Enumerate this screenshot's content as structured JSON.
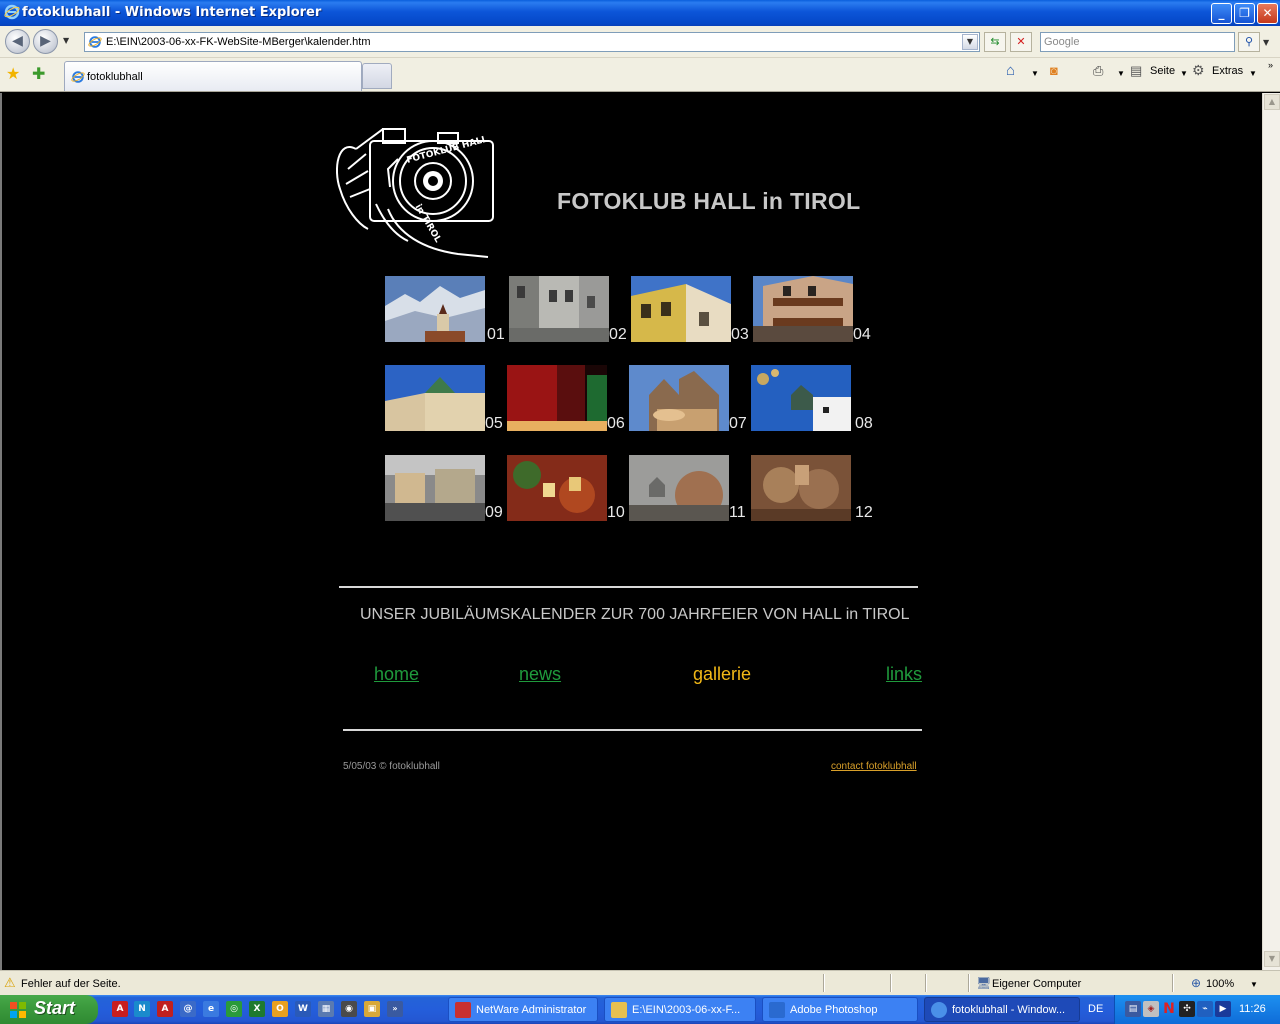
{
  "window": {
    "title": "fotoklubhall - Windows Internet Explorer"
  },
  "navbar": {
    "address": "E:\\EIN\\2003-06-xx-FK-WebSite-MBerger\\kalender.htm",
    "search_placeholder": "Google"
  },
  "tabbar": {
    "tab_label": "fotoklubhall",
    "page_label": "Seite",
    "tools_label": "Extras"
  },
  "page": {
    "site_title": "FOTOKLUB HALL in TIROL",
    "thumbnails": [
      {
        "num": "01"
      },
      {
        "num": "02"
      },
      {
        "num": "03"
      },
      {
        "num": "04"
      },
      {
        "num": "05"
      },
      {
        "num": "06"
      },
      {
        "num": "07"
      },
      {
        "num": "08"
      },
      {
        "num": "09"
      },
      {
        "num": "10"
      },
      {
        "num": "11"
      },
      {
        "num": "12"
      }
    ],
    "subtitle": "UNSER JUBILÄUMSKALENDER ZUR 700 JAHRFEIER VON HALL in TIROL",
    "nav": {
      "home": "home",
      "news": "news",
      "gallery": "gallerie",
      "links": "links"
    },
    "footer_left": "5/05/03 © fotoklubhall",
    "footer_right": "contact fotoklubhall",
    "colors": {
      "link": "#1f9a3c",
      "active_link": "#f2b817",
      "footer_link": "#d9a02a"
    }
  },
  "statusbar": {
    "message": "Fehler auf der Seite.",
    "zone": "Eigener Computer",
    "zoom": "100%"
  },
  "taskbar": {
    "start": "Start",
    "items": [
      {
        "label": "NetWare Administrator"
      },
      {
        "label": "E:\\EIN\\2003-06-xx-F..."
      },
      {
        "label": "Adobe Photoshop"
      },
      {
        "label": "fotoklubhall - Window..."
      }
    ],
    "language": "DE",
    "time": "11:26"
  }
}
